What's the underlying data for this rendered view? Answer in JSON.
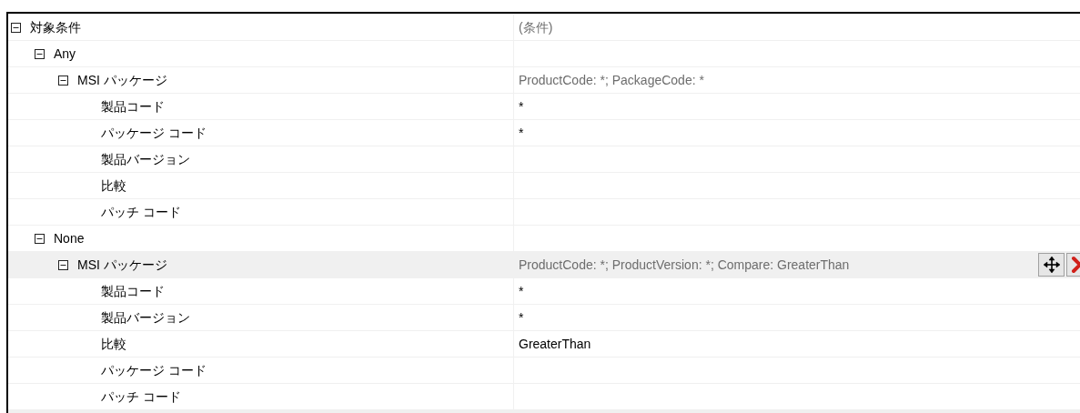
{
  "tree": [
    {
      "label": "対象条件",
      "value": "(条件)",
      "kind": "group",
      "expanded": true,
      "selected": false,
      "children": [
        {
          "label": "Any",
          "kind": "group",
          "expanded": true,
          "selected": false,
          "children": [
            {
              "label": "MSI パッケージ",
              "value": "ProductCode: *; PackageCode: *",
              "kind": "group",
              "expanded": true,
              "selected": false,
              "children": [
                {
                  "label": "製品コード",
                  "value": "*",
                  "kind": "property",
                  "selected": false
                },
                {
                  "label": "パッケージ コード",
                  "value": "*",
                  "kind": "property",
                  "selected": false
                },
                {
                  "label": "製品バージョン",
                  "kind": "property",
                  "selected": false
                },
                {
                  "label": "比較",
                  "kind": "property",
                  "selected": false
                },
                {
                  "label": "パッチ コード",
                  "kind": "property",
                  "selected": false
                }
              ]
            }
          ]
        },
        {
          "label": "None",
          "kind": "group",
          "expanded": true,
          "selected": false,
          "children": [
            {
              "label": "MSI パッケージ",
              "value": "ProductCode: *; ProductVersion: *; Compare: GreaterThan",
              "kind": "group",
              "expanded": true,
              "selected": true,
              "children": [
                {
                  "label": "製品コード",
                  "value": "*",
                  "kind": "property",
                  "selected": false
                },
                {
                  "label": "製品バージョン",
                  "value": "*",
                  "kind": "property",
                  "selected": false
                },
                {
                  "label": "比較",
                  "value": "GreaterThan",
                  "kind": "property",
                  "selected": false
                },
                {
                  "label": "パッケージ コード",
                  "kind": "property",
                  "selected": false
                },
                {
                  "label": "パッチ コード",
                  "kind": "property",
                  "selected": false
                }
              ]
            }
          ]
        }
      ]
    }
  ]
}
